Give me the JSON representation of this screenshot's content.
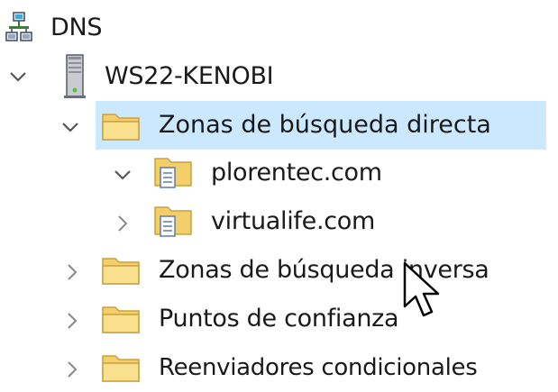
{
  "tree": {
    "root": {
      "label": "DNS",
      "icon": "dns-manager-icon"
    },
    "server": {
      "label": "WS22-KENOBI",
      "icon": "server-tower-icon",
      "expanded": true
    },
    "zones": [
      {
        "label": "Zonas de búsqueda directa",
        "icon": "folder-icon",
        "expanded": true,
        "selected": true,
        "children": [
          {
            "label": "plorentec.com",
            "icon": "zone-file-icon",
            "expanded": true
          },
          {
            "label": "virtualife.com",
            "icon": "zone-file-icon",
            "expanded": false
          }
        ]
      },
      {
        "label": "Zonas de búsqueda inversa",
        "icon": "folder-icon",
        "expanded": false
      },
      {
        "label": "Puntos de confianza",
        "icon": "folder-icon",
        "expanded": false
      },
      {
        "label": "Reenviadores condicionales",
        "icon": "folder-icon",
        "expanded": false
      }
    ]
  },
  "colors": {
    "selection": "#cce8ff",
    "folder": "#f5d77a",
    "chevron": "#555555"
  }
}
